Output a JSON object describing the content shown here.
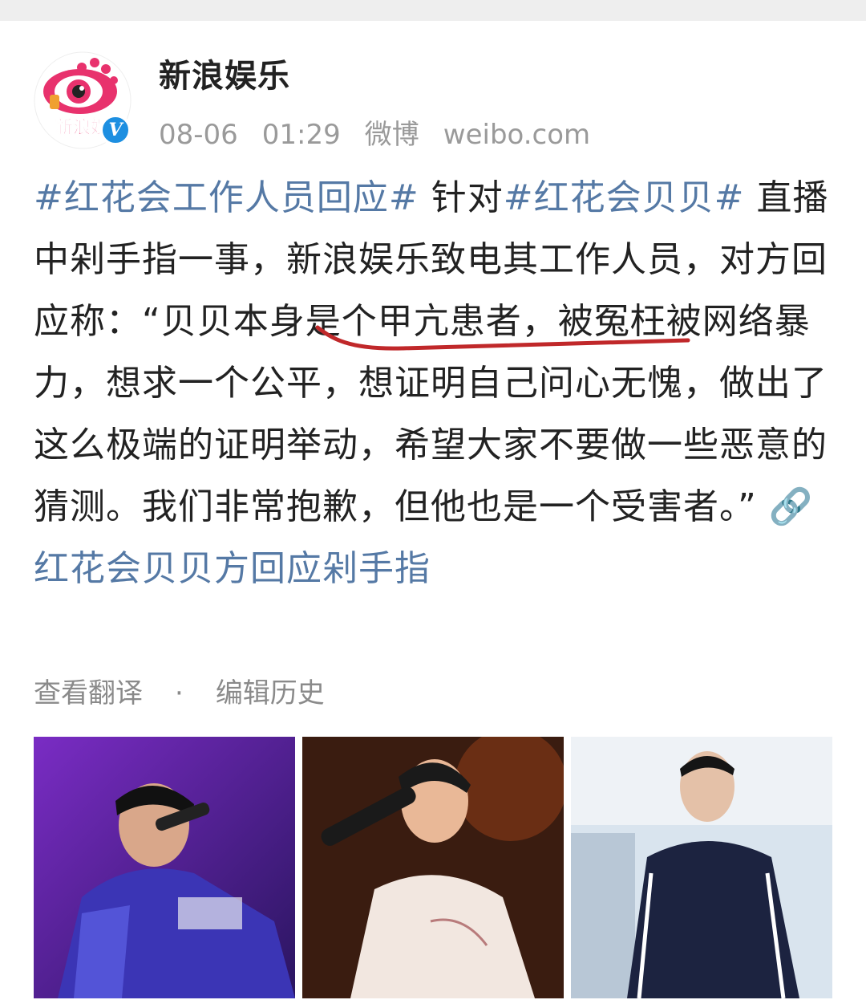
{
  "post": {
    "author": "新浪娱乐",
    "avatar_label": "新浪娱",
    "verified_mark": "V",
    "meta": {
      "date": "08-06",
      "time": "01:29",
      "source": "微博",
      "site": "weibo.com"
    },
    "content": {
      "topic1": "#红花会工作人员回应#",
      "text1": " 针对",
      "topic2": "#红花会贝贝#",
      "text2": " 直播中剁手指一事，新浪娱乐致电其工作人员，对方回应称：“",
      "underlined": "贝贝本身是个甲亢患者",
      "text3": "，被冤枉被网络暴力，想求一个公平，想证明自己问心无愧，做出了这么极端的证明举动，希望大家不要做一些恶意的猜测。我们非常抱歉，但他也是一个受害者。” ",
      "link": "红花会贝贝方回应剁手指"
    },
    "actions": {
      "translate": "查看翻译",
      "separator": "·",
      "history": "编辑历史"
    }
  },
  "colors": {
    "topic": "#5579a5",
    "text": "#222222",
    "meta": "#9a9a9a",
    "underline": "#c0282a",
    "verified": "#1d8fe1"
  },
  "icons": [
    "weibo-eye-logo",
    "verified-badge",
    "link-icon"
  ]
}
